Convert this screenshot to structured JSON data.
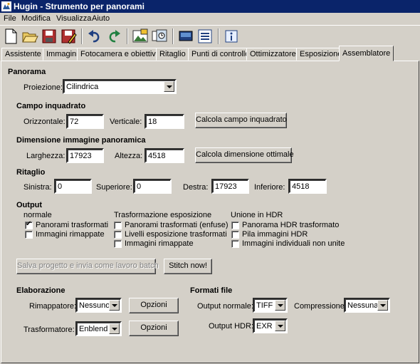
{
  "window": {
    "title": "Hugin - Strumento per panorami"
  },
  "menu": [
    "File",
    "Modifica",
    "Visualizza",
    "Aiuto"
  ],
  "toolbar": {
    "icons": [
      "new-icon",
      "open-icon",
      "save-icon",
      "save-as-icon",
      "undo-icon",
      "redo-icon",
      "add-images-icon",
      "add-time-series-icon",
      "preview-icon",
      "control-points-table-icon",
      "about-icon"
    ]
  },
  "tabs": [
    "Assistente",
    "Immagini",
    "Fotocamera e obiettivo",
    "Ritaglio",
    "Punti di controllo",
    "Ottimizzatore",
    "Esposizione",
    "Assemblatore"
  ],
  "active_tab": "Assemblatore",
  "panorama": {
    "header": "Panorama",
    "projection_label": "Proiezione:",
    "projection_value": "Cilindrica"
  },
  "fov": {
    "header": "Campo inquadrato",
    "h_label": "Orizzontale:",
    "h_value": "72",
    "v_label": "Verticale:",
    "v_value": "18",
    "calc_button": "Calcola campo inquadrato"
  },
  "size": {
    "header": "Dimensione immagine panoramica",
    "width_label": "Larghezza:",
    "width_value": "17923",
    "height_label": "Altezza:",
    "height_value": "4518",
    "calc_button": "Calcola dimensione ottimale"
  },
  "crop": {
    "header": "Ritaglio",
    "left_label": "Sinistra:",
    "left_value": "0",
    "top_label": "Superiore:",
    "top_value": "0",
    "right_label": "Destra:",
    "right_value": "17923",
    "bottom_label": "Inferiore:",
    "bottom_value": "4518"
  },
  "output": {
    "header": "Output",
    "normal": {
      "title": "normale",
      "items": [
        {
          "label": "Panorami trasformati",
          "checked": true
        },
        {
          "label": "Immagini rimappate",
          "checked": false
        }
      ]
    },
    "exposure": {
      "title": "Trasformazione esposizione",
      "items": [
        {
          "label": "Panorami trasformati (enfuse)",
          "checked": false
        },
        {
          "label": "Livelli esposizione trasformati",
          "checked": false
        },
        {
          "label": "Immagini rimappate",
          "checked": false
        }
      ]
    },
    "hdr": {
      "title": "Unione in HDR",
      "items": [
        {
          "label": "Panorama HDR trasformato",
          "checked": false
        },
        {
          "label": "Pila immagini HDR",
          "checked": false
        },
        {
          "label": "Immagini individuali non unite",
          "checked": false
        }
      ]
    }
  },
  "actions": {
    "batch_button": "Salva progetto e invia come lavoro batch",
    "stitch_button": "Stitch now!"
  },
  "processing": {
    "header": "Elaborazione",
    "remapper_label": "Rimappatore:",
    "remapper_value": "Nessuno",
    "remapper_options": "Opzioni",
    "blender_label": "Trasformatore:",
    "blender_value": "Enblend",
    "blender_options": "Opzioni"
  },
  "formats": {
    "header": "Formati file",
    "normal_label": "Output normale:",
    "normal_value": "TIFF",
    "compression_label": "Compressione:",
    "compression_value": "Nessuna",
    "hdr_label": "Output HDR:",
    "hdr_value": "EXR"
  }
}
